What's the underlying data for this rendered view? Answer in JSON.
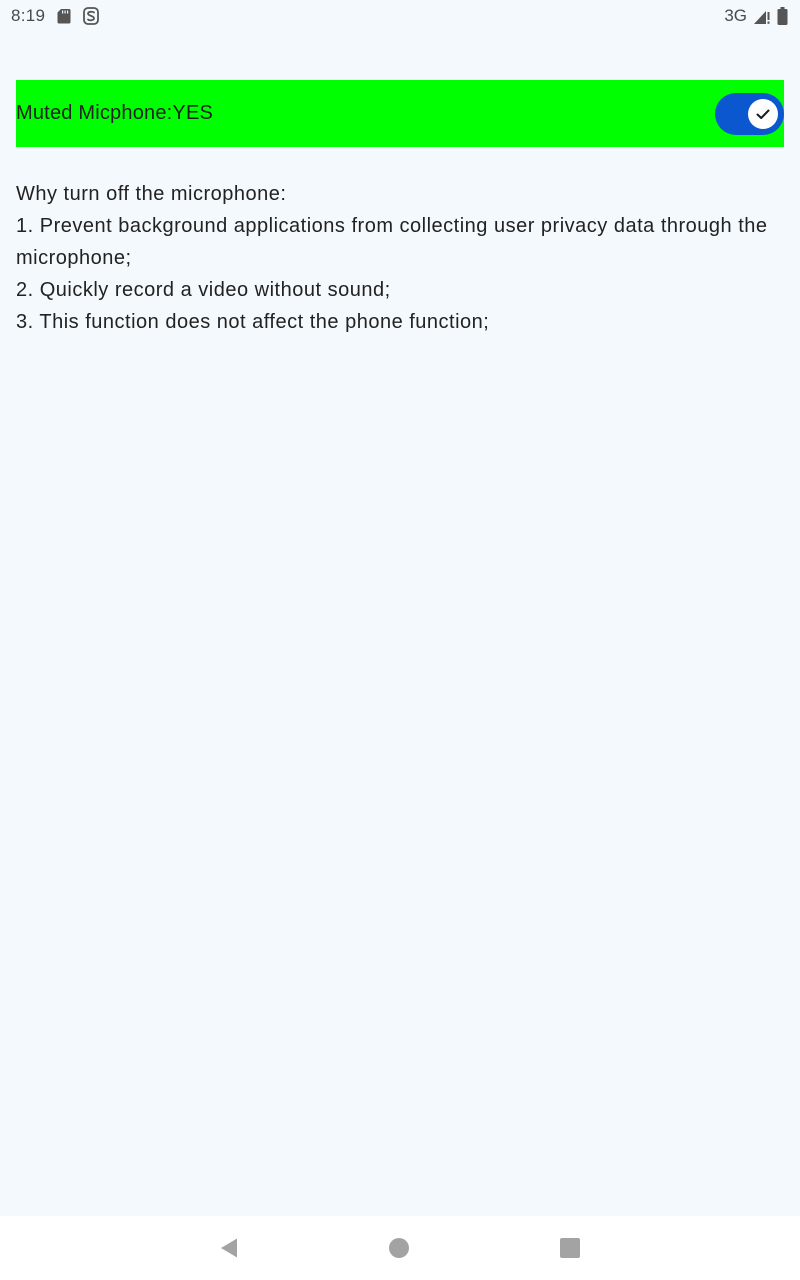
{
  "status_bar": {
    "time": "8:19",
    "network": "3G",
    "icons": [
      "sd-card-icon",
      "s-notification-icon",
      "signal-icon",
      "battery-icon"
    ]
  },
  "mute_setting": {
    "label": "Muted Micphone:YES",
    "toggle_on": true,
    "background_color": "#00ff00",
    "switch_color": "#0b57d0"
  },
  "explanation": {
    "heading": "Why turn off the microphone:",
    "items": [
      "1. Prevent background applications from collecting user privacy data through the microphone;",
      "2. Quickly record a video without sound;",
      "3. This function does not affect the phone function;"
    ]
  },
  "nav_bar": {
    "buttons": [
      "back-icon",
      "home-icon",
      "recents-icon"
    ]
  }
}
